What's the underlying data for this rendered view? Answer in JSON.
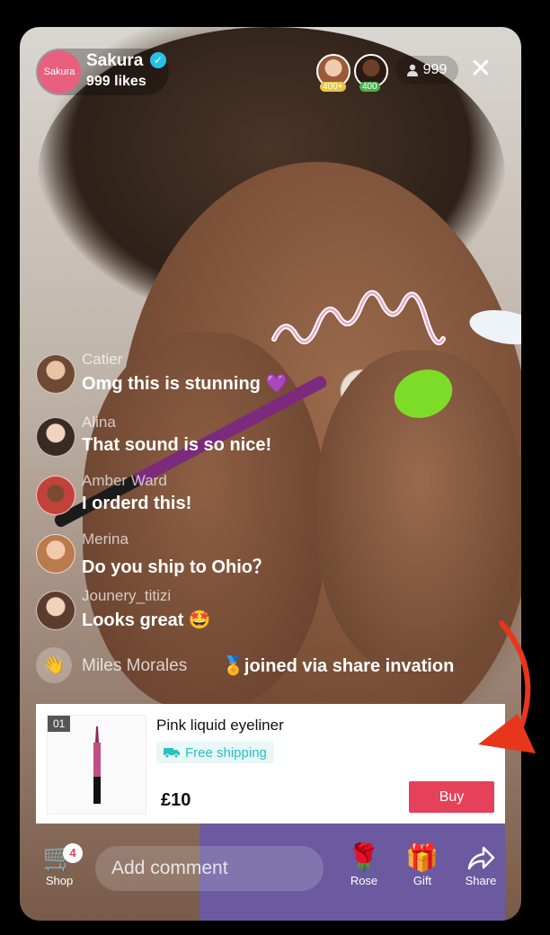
{
  "host": {
    "avatar_text": "Sakura",
    "name": "Sakura",
    "likes": "999 likes",
    "verified_icon": "verified-check-icon"
  },
  "top_viewers": [
    {
      "badge": "400+",
      "color": "#e7c547"
    },
    {
      "badge": "400",
      "color": "#4caf50"
    }
  ],
  "viewer_count": "999",
  "comments": [
    {
      "name": "Catier",
      "text": "Omg this is stunning 💜"
    },
    {
      "name": "Alina",
      "text": "That sound is so nice!"
    },
    {
      "name": "Amber Ward",
      "text": "I orderd this!"
    },
    {
      "name": "Merina",
      "text": "Do you ship to Ohio？"
    },
    {
      "name": "Jounery_titizi",
      "text": "Looks great 🤩"
    }
  ],
  "join_event": {
    "name": "Miles Morales",
    "text": "🏅joined via share invation"
  },
  "product": {
    "index": "01",
    "title": "Pink liquid eyeliner",
    "shipping": "Free shipping",
    "price": "£10",
    "buy_label": "Buy"
  },
  "bottom_bar": {
    "shop_label": "Shop",
    "shop_count": "4",
    "comment_placeholder": "Add comment",
    "rose_label": "Rose",
    "gift_label": "Gift",
    "share_label": "Share"
  },
  "colors": {
    "accent": "#e5415a",
    "shipping": "#2bc0c4",
    "arrow": "#e8361c"
  }
}
